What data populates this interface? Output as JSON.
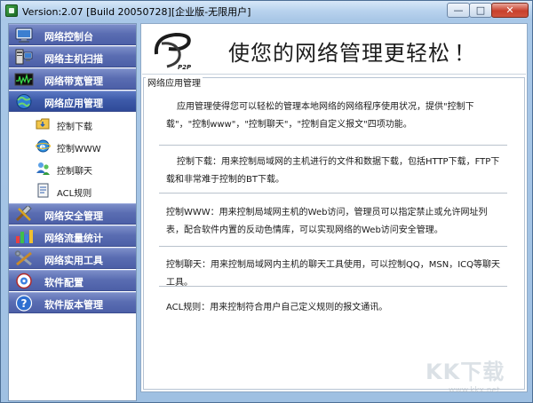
{
  "window": {
    "title": "Version:2.07 [Build 20050728][企业版-无限用户]",
    "controls": {
      "minimize": "—",
      "maximize": "□",
      "close": "✕"
    }
  },
  "sidebar": {
    "items": [
      {
        "label": "网络控制台",
        "icon": "monitor-icon"
      },
      {
        "label": "网络主机扫描",
        "icon": "host-scan-icon"
      },
      {
        "label": "网络带宽管理",
        "icon": "bandwidth-icon"
      },
      {
        "label": "网络应用管理",
        "icon": "network-app-icon",
        "active": true
      },
      {
        "label": "网络安全管理",
        "icon": "tools-icon"
      },
      {
        "label": "网络流量统计",
        "icon": "bar-chart-icon"
      },
      {
        "label": "网络实用工具",
        "icon": "wrench-icon"
      },
      {
        "label": "软件配置",
        "icon": "settings-icon"
      },
      {
        "label": "软件版本管理",
        "icon": "help-icon"
      }
    ],
    "sub_items": [
      {
        "label": "控制下载",
        "icon": "download-folder-icon"
      },
      {
        "label": "控制WWW",
        "icon": "browser-icon"
      },
      {
        "label": "控制聊天",
        "icon": "chat-users-icon"
      },
      {
        "label": "ACL规则",
        "icon": "rules-icon"
      }
    ]
  },
  "banner": {
    "logo_text": "P2P",
    "title": "使您的网络管理更轻松",
    "exclaim": "！"
  },
  "section": {
    "caption": "网络应用管理",
    "paragraphs": [
      "应用管理使得您可以轻松的管理本地网络的网络程序使用状况，提供\"控制下载\"，\"控制www\"，\"控制聊天\"，\"控制自定义报文\"四项功能。",
      "控制下载：用来控制局域网的主机进行的文件和数据下载，包括HTTP下载，FTP下载和非常难于控制的BT下载。",
      "控制WWW：用来控制局域网主机的Web访问，管理员可以指定禁止或允许网址列表，配合软件内置的反动色情库，可以实现网络的Web访问安全管理。",
      "控制聊天：用来控制局域网内主机的聊天工具使用，可以控制QQ，MSN，ICQ等聊天工具。",
      "ACL规则：用来控制符合用户自己定义规则的报文通讯。"
    ]
  },
  "watermark": {
    "main": "KK下载",
    "sub": "www.kkx.net"
  }
}
